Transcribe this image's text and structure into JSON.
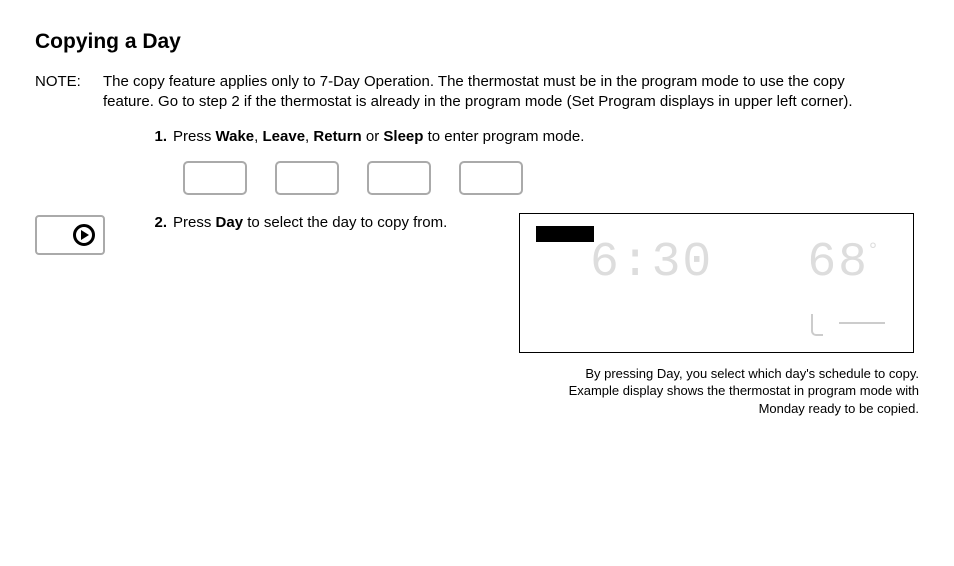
{
  "heading": "Copying a Day",
  "note_label": "NOTE:",
  "note_body": "The copy feature applies only to 7-Day Operation. The thermostat must be in the program mode to use the copy feature. Go to step 2 if the thermostat is already in the program mode (Set Program displays in upper left corner).",
  "step1": {
    "num": "1.",
    "pre": "Press ",
    "k1": "Wake",
    "s1": ", ",
    "k2": "Leave",
    "s2": ", ",
    "k3": "Return",
    "s3": " or ",
    "k4": "Sleep",
    "post": " to enter program mode."
  },
  "step2": {
    "num": "2.",
    "pre": "Press ",
    "k1": "Day",
    "post": " to select the day to copy from."
  },
  "display": {
    "time": "6:30",
    "temp": "68",
    "degree": "°"
  },
  "caption_l1": "By pressing Day, you select which day's schedule to copy.",
  "caption_l2": "Example display shows the thermostat in program mode with",
  "caption_l3": "Monday ready to be copied."
}
